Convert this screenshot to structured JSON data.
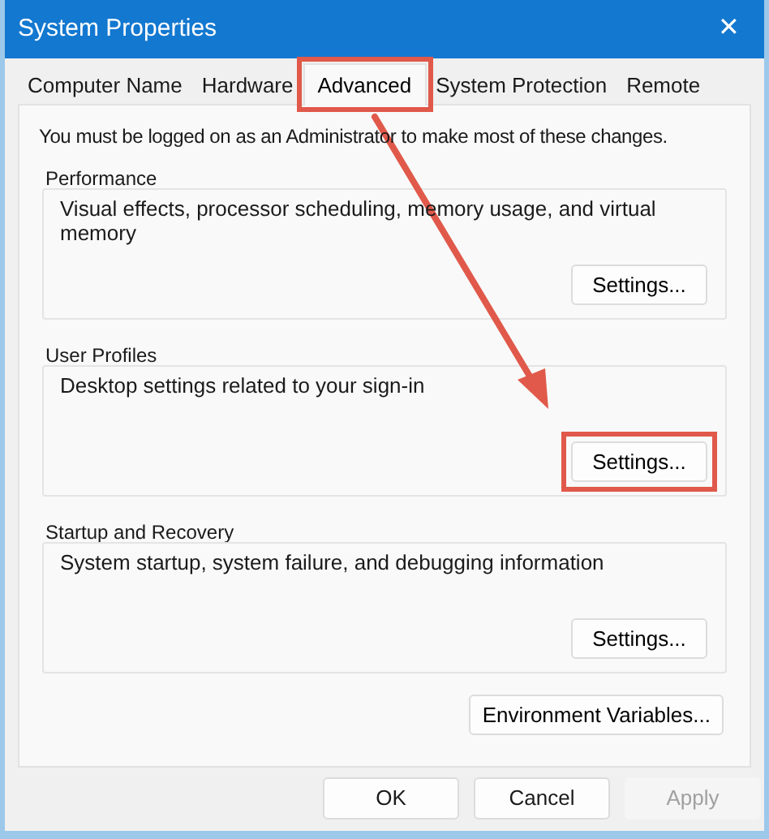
{
  "window": {
    "title": "System Properties",
    "close": "✕"
  },
  "tabs": [
    {
      "label": "Computer Name",
      "selected": false,
      "highlighted": false
    },
    {
      "label": "Hardware",
      "selected": false,
      "highlighted": false
    },
    {
      "label": "Advanced",
      "selected": true,
      "highlighted": true
    },
    {
      "label": "System Protection",
      "selected": false,
      "highlighted": false
    },
    {
      "label": "Remote",
      "selected": false,
      "highlighted": false
    }
  ],
  "notice": "You must be logged on as an Administrator to make most of these changes.",
  "groups": [
    {
      "title": "Performance",
      "description": "Visual effects, processor scheduling, memory usage, and virtual memory",
      "button": {
        "label": "Settings...",
        "highlighted": false
      }
    },
    {
      "title": "User Profiles",
      "description": "Desktop settings related to your sign-in",
      "button": {
        "label": "Settings...",
        "highlighted": true
      }
    },
    {
      "title": "Startup and Recovery",
      "description": "System startup, system failure, and debugging information",
      "button": {
        "label": "Settings...",
        "highlighted": false
      }
    }
  ],
  "environment_button": "Environment Variables...",
  "buttons": [
    {
      "label": "OK",
      "disabled": false
    },
    {
      "label": "Cancel",
      "disabled": false
    },
    {
      "label": "Apply",
      "disabled": true
    }
  ],
  "annotation": {
    "arrow": true
  }
}
